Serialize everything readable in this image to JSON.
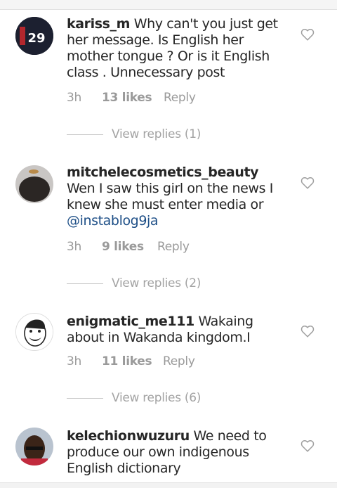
{
  "comments": [
    {
      "username": "kariss_m",
      "text": "Why can't you just get her message. Is English her mother tongue ? Or is it English class . Unnecessary post",
      "time": "3h",
      "likes": "13 likes",
      "reply": "Reply",
      "view_replies": "View replies (1)",
      "avatar_badge": "29"
    },
    {
      "username": "mitchelecosmetics_beauty",
      "text": "Wen I saw this girl on the news I knew she must enter media or ",
      "mention": "@instablog9ja",
      "time": "3h",
      "likes": "9 likes",
      "reply": "Reply",
      "view_replies": "View replies (2)"
    },
    {
      "username": "enigmatic_me111",
      "text": "Wakaing about in Wakanda kingdom.I",
      "time": "3h",
      "likes": "11 likes",
      "reply": "Reply",
      "view_replies": "View replies (6)"
    },
    {
      "username": "kelechionwuzuru",
      "text": "We need to produce  our own indigenous English  dictionary"
    }
  ],
  "icons": {
    "like": "heart-outline-icon"
  },
  "colors": {
    "mention": "#1e4f87",
    "meta": "#9a9a9a"
  }
}
